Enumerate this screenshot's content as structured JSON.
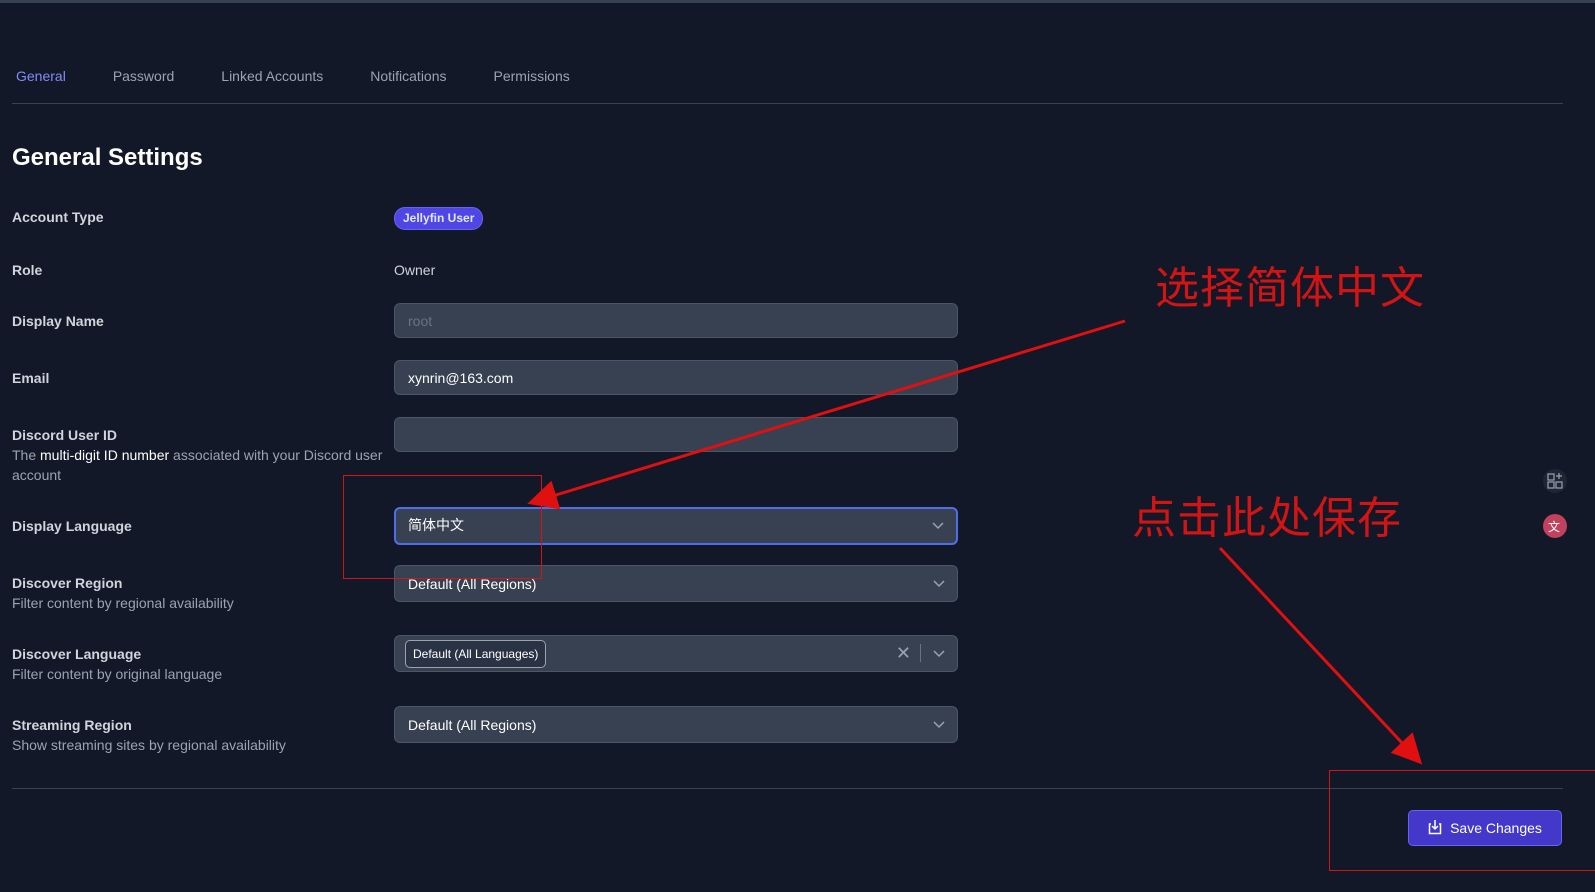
{
  "tabs": [
    "General",
    "Password",
    "Linked Accounts",
    "Notifications",
    "Permissions"
  ],
  "page_title": "General Settings",
  "account_type": {
    "label": "Account Type",
    "value": "Jellyfin User"
  },
  "role": {
    "label": "Role",
    "value": "Owner"
  },
  "display_name": {
    "label": "Display Name",
    "value": "root"
  },
  "email": {
    "label": "Email",
    "value": "xynrin@163.com"
  },
  "discord": {
    "label": "Discord User ID",
    "desc_pre": "The ",
    "desc_bold": "multi-digit ID number",
    "desc_post": " associated with your Discord user account",
    "value": ""
  },
  "display_language": {
    "label": "Display Language",
    "value": "简体中文"
  },
  "discover_region": {
    "label": "Discover Region",
    "desc": "Filter content by regional availability",
    "value": "Default (All Regions)"
  },
  "discover_language": {
    "label": "Discover Language",
    "desc": "Filter content by original language",
    "value": "Default (All Languages)"
  },
  "streaming_region": {
    "label": "Streaming Region",
    "desc": "Show streaming sites by regional availability",
    "value": "Default (All Regions)"
  },
  "save_label": "Save Changes",
  "annotations": {
    "select_text": "选择简体中文",
    "save_text": "点击此处保存",
    "color": "#d11414"
  },
  "colors": {
    "accent": "#4f46e5",
    "background": "#121828",
    "input": "#374151"
  }
}
